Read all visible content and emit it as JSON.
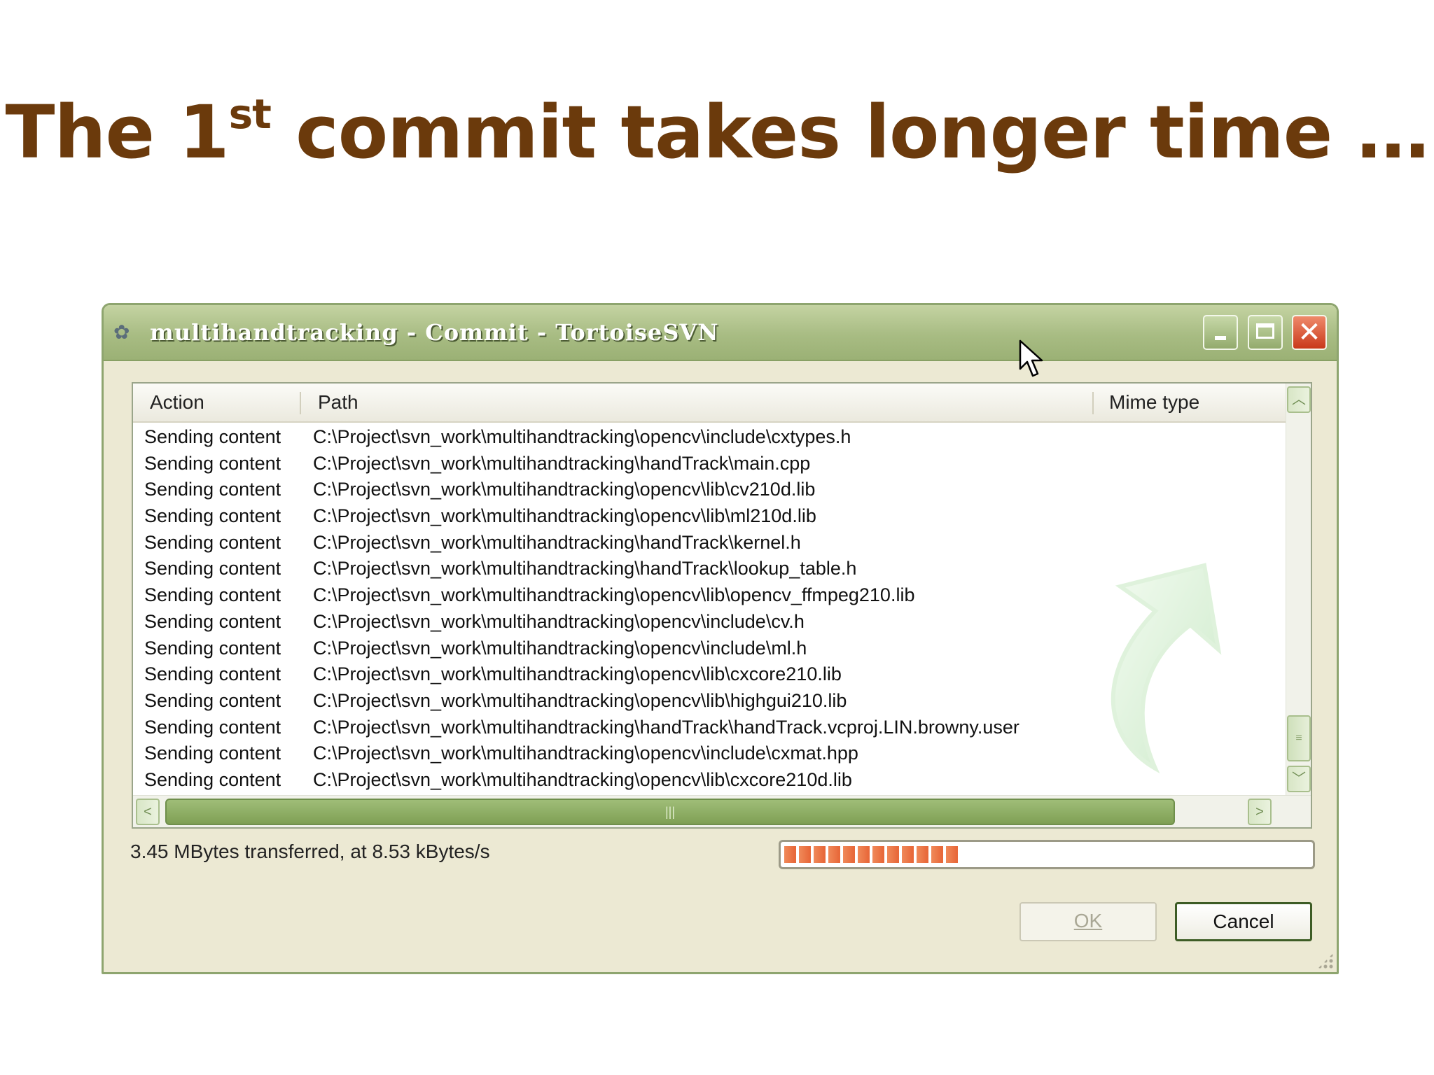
{
  "slide": {
    "title_prefix": "The 1",
    "title_superscript": "st",
    "title_suffix": " commit takes longer time …"
  },
  "window": {
    "title": "multihandtracking - Commit - TortoiseSVN",
    "icon": "tortoisesvn-icon"
  },
  "list": {
    "columns": [
      "Action",
      "Path",
      "Mime type"
    ],
    "rows": [
      {
        "action": "Sending content",
        "path": "C:\\Project\\svn_work\\multihandtracking\\opencv\\include\\cxtypes.h"
      },
      {
        "action": "Sending content",
        "path": "C:\\Project\\svn_work\\multihandtracking\\handTrack\\main.cpp"
      },
      {
        "action": "Sending content",
        "path": "C:\\Project\\svn_work\\multihandtracking\\opencv\\lib\\cv210d.lib"
      },
      {
        "action": "Sending content",
        "path": "C:\\Project\\svn_work\\multihandtracking\\opencv\\lib\\ml210d.lib"
      },
      {
        "action": "Sending content",
        "path": "C:\\Project\\svn_work\\multihandtracking\\handTrack\\kernel.h"
      },
      {
        "action": "Sending content",
        "path": "C:\\Project\\svn_work\\multihandtracking\\handTrack\\lookup_table.h"
      },
      {
        "action": "Sending content",
        "path": "C:\\Project\\svn_work\\multihandtracking\\opencv\\lib\\opencv_ffmpeg210.lib"
      },
      {
        "action": "Sending content",
        "path": "C:\\Project\\svn_work\\multihandtracking\\opencv\\include\\cv.h"
      },
      {
        "action": "Sending content",
        "path": "C:\\Project\\svn_work\\multihandtracking\\opencv\\include\\ml.h"
      },
      {
        "action": "Sending content",
        "path": "C:\\Project\\svn_work\\multihandtracking\\opencv\\lib\\cxcore210.lib"
      },
      {
        "action": "Sending content",
        "path": "C:\\Project\\svn_work\\multihandtracking\\opencv\\lib\\highgui210.lib"
      },
      {
        "action": "Sending content",
        "path": "C:\\Project\\svn_work\\multihandtracking\\handTrack\\handTrack.vcproj.LIN.browny.user"
      },
      {
        "action": "Sending content",
        "path": "C:\\Project\\svn_work\\multihandtracking\\opencv\\include\\cxmat.hpp"
      },
      {
        "action": "Sending content",
        "path": "C:\\Project\\svn_work\\multihandtracking\\opencv\\lib\\cxcore210d.lib"
      }
    ]
  },
  "status": {
    "transfer_text": "3.45 MBytes transferred, at 8.53 kBytes/s",
    "progress_fraction": 0.33
  },
  "buttons": {
    "ok": "OK",
    "cancel": "Cancel"
  },
  "colors": {
    "title_text": "#6b3a0c",
    "titlebar": "#a8bc83",
    "progress": "#e8693a"
  }
}
